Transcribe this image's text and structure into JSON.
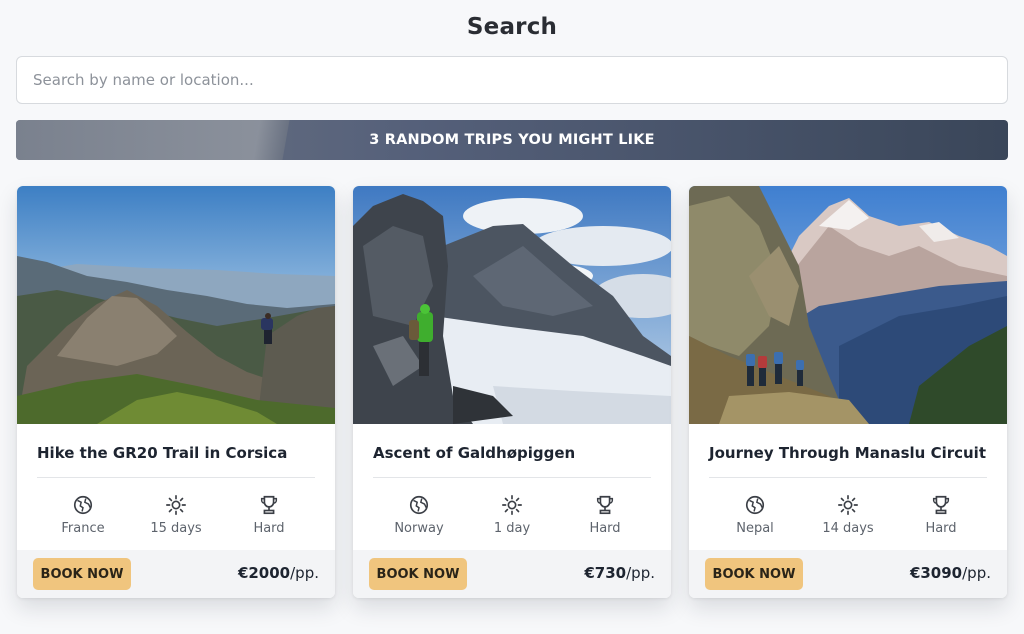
{
  "page_title": "Search",
  "search": {
    "placeholder": "Search by name or location..."
  },
  "banner": {
    "text": "3 RANDOM TRIPS YOU MIGHT LIKE"
  },
  "colors": {
    "book_button": "#f0c57e",
    "banner_dark": "#3a4659",
    "banner_light": "#8b919c"
  },
  "trips": [
    {
      "title": "Hike the GR20 Trail in Corsica",
      "location": "France",
      "duration": "15 days",
      "difficulty": "Hard",
      "book_label": "BOOK NOW",
      "price": "€2000",
      "price_unit": "/pp."
    },
    {
      "title": "Ascent of Galdhøpiggen",
      "location": "Norway",
      "duration": "1 day",
      "difficulty": "Hard",
      "book_label": "BOOK NOW",
      "price": "€730",
      "price_unit": "/pp."
    },
    {
      "title": "Journey Through Manaslu Circuit",
      "location": "Nepal",
      "duration": "14 days",
      "difficulty": "Hard",
      "book_label": "BOOK NOW",
      "price": "€3090",
      "price_unit": "/pp."
    }
  ],
  "icons": {
    "location": "globe-icon",
    "duration": "sun-icon",
    "difficulty": "trophy-icon"
  }
}
